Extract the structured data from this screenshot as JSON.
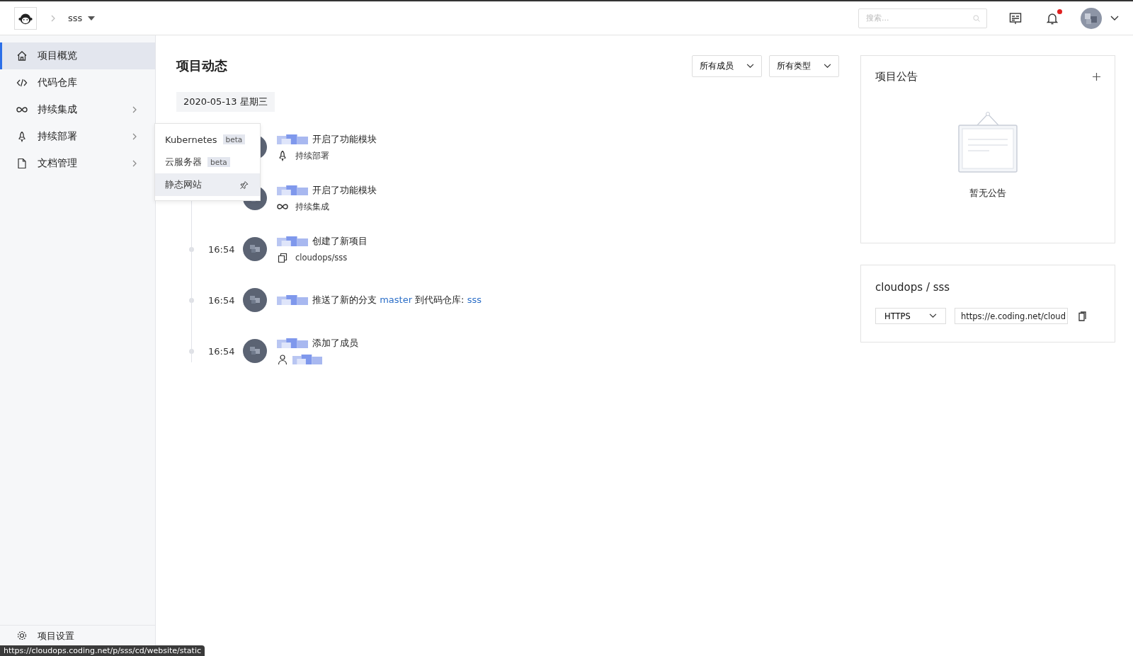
{
  "topbar": {
    "project": "sss",
    "search": {
      "placeholder": "搜索..."
    },
    "notification_dot": true
  },
  "sidebar": {
    "items": [
      {
        "label": "项目概览",
        "kind": "home",
        "selected": true,
        "expandable": false
      },
      {
        "label": "代码仓库",
        "kind": "code",
        "selected": false,
        "expandable": false
      },
      {
        "label": "持续集成",
        "kind": "infinity",
        "selected": false,
        "expandable": true
      },
      {
        "label": "持续部署",
        "kind": "rocket",
        "selected": false,
        "expandable": true
      },
      {
        "label": "文档管理",
        "kind": "file",
        "selected": false,
        "expandable": true
      }
    ],
    "footer": {
      "label": "项目设置"
    }
  },
  "flyout_menu": {
    "items": [
      {
        "label": "Kubernetes",
        "badge": "beta",
        "selected": false,
        "pinned": false
      },
      {
        "label": "云服务器",
        "badge": "beta",
        "selected": false,
        "pinned": false
      },
      {
        "label": "静态网站",
        "selected": true,
        "pinned": true
      }
    ]
  },
  "activity": {
    "title": "项目动态",
    "filters": [
      "所有成员",
      "所有类型"
    ],
    "date": "2020-05-13 星期三",
    "events": [
      {
        "action": "开启了功能模块",
        "detail": {
          "kind": "rocket",
          "text": "持续部署"
        }
      },
      {
        "action": "开启了功能模块",
        "detail": {
          "kind": "infinity",
          "text": "持续集成"
        }
      },
      {
        "time": "16:54",
        "action": "创建了新项目",
        "detail": {
          "kind": "repo",
          "text": "cloudops/sss"
        }
      },
      {
        "time": "16:54",
        "action": "推送了新的分支 ",
        "branch": "master",
        "action2": " 到代码仓库: ",
        "repo": "sss"
      },
      {
        "time": "16:54",
        "action": "添加了成员",
        "detail": {
          "kind": "member"
        }
      }
    ]
  },
  "announcement": {
    "title": "项目公告",
    "empty_text": "暂无公告"
  },
  "repo_card": {
    "title": "cloudops / sss",
    "protocol": "HTTPS",
    "url": "https://e.coding.net/cloud"
  },
  "status_url": "https://cloudops.coding.net/p/sss/cd/website/static"
}
